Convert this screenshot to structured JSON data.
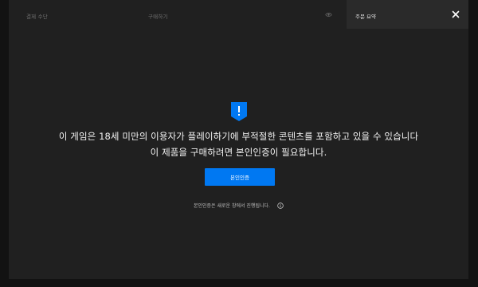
{
  "topbar": {
    "steps": [
      {
        "label": "결제 수단"
      },
      {
        "label": "구매하기"
      }
    ],
    "eye_icon": "eye-icon",
    "summary_tab": {
      "label": "주문 요약"
    },
    "close_icon": "close-icon"
  },
  "main": {
    "icon": "shield-alert-icon",
    "line1": "이 게임은 18세 미만의 이용자가 플레이하기에 부적절한 콘텐츠를 포함하고 있을 수 있습니다",
    "line2": "이 제품을 구매하려면 본인인증이 필요합니다.",
    "button_label": "본인인증",
    "note": "본인인증은 새로운 창에서 진행됩니다.",
    "note_icon": "info-icon"
  },
  "colors": {
    "background": "#121212",
    "panel": "#202020",
    "tab": "#2a2a2a",
    "accent": "#0078f2",
    "text": "#f2f2f2",
    "muted": "#6f6f6f"
  }
}
